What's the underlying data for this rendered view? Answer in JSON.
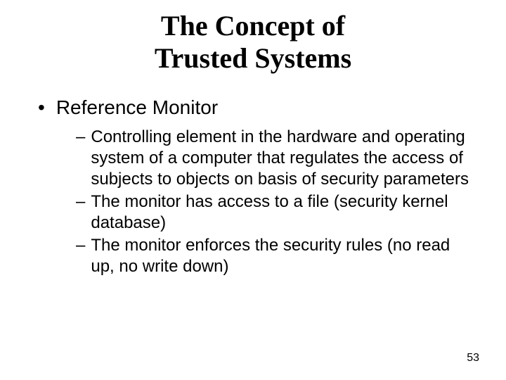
{
  "title_line1": "The Concept of",
  "title_line2": "Trusted Systems",
  "main_bullet": "Reference Monitor",
  "sub_bullets": [
    "Controlling element in the hardware and operating system of a computer that regulates the access of subjects to objects on basis of security parameters",
    "The monitor has access to a file (security kernel database)",
    "The monitor enforces the security rules (no read up, no write down)"
  ],
  "page_number": "53"
}
